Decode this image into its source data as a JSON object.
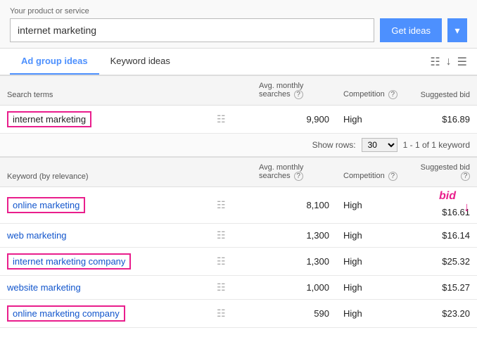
{
  "topbar": {
    "label": "Your product or service",
    "input_value": "internet marketing",
    "get_ideas_label": "Get ideas",
    "more_label": "▾"
  },
  "tabs": {
    "items": [
      {
        "label": "Ad group ideas",
        "active": true
      },
      {
        "label": "Keyword ideas",
        "active": false
      }
    ]
  },
  "search_terms_table": {
    "headers": {
      "term": "Search terms",
      "avg": "Avg. monthly",
      "searches": "searches",
      "competition": "Competition",
      "help": "?",
      "bid": "Suggested bid"
    },
    "rows": [
      {
        "term": "internet marketing",
        "avg_searches": "9,900",
        "competition": "High",
        "suggested_bid": "$16.89",
        "outlined": true
      }
    ]
  },
  "show_rows": {
    "label": "Show rows:",
    "value": "30",
    "pagination": "1 - 1 of 1 keyword"
  },
  "keyword_ideas_table": {
    "headers": {
      "keyword": "Keyword (by relevance)",
      "avg": "Avg. monthly",
      "searches": "searches",
      "help": "?",
      "competition": "Competition",
      "comp_help": "?",
      "bid": "Suggested bid",
      "bid_help": "?"
    },
    "bid_annotation": "bid",
    "rows": [
      {
        "keyword": "online marketing",
        "avg_searches": "8,100",
        "competition": "High",
        "suggested_bid": "$16.61",
        "outlined": true,
        "has_bid_annotation": true
      },
      {
        "keyword": "web marketing",
        "avg_searches": "1,300",
        "competition": "High",
        "suggested_bid": "$16.14",
        "outlined": false,
        "has_bid_annotation": false
      },
      {
        "keyword": "internet marketing company",
        "avg_searches": "1,300",
        "competition": "High",
        "suggested_bid": "$25.32",
        "outlined": true,
        "has_bid_annotation": false
      },
      {
        "keyword": "website marketing",
        "avg_searches": "1,000",
        "competition": "High",
        "suggested_bid": "$15.27",
        "outlined": false,
        "has_bid_annotation": false
      },
      {
        "keyword": "online marketing company",
        "avg_searches": "590",
        "competition": "High",
        "suggested_bid": "$23.20",
        "outlined": true,
        "has_bid_annotation": false
      }
    ]
  }
}
